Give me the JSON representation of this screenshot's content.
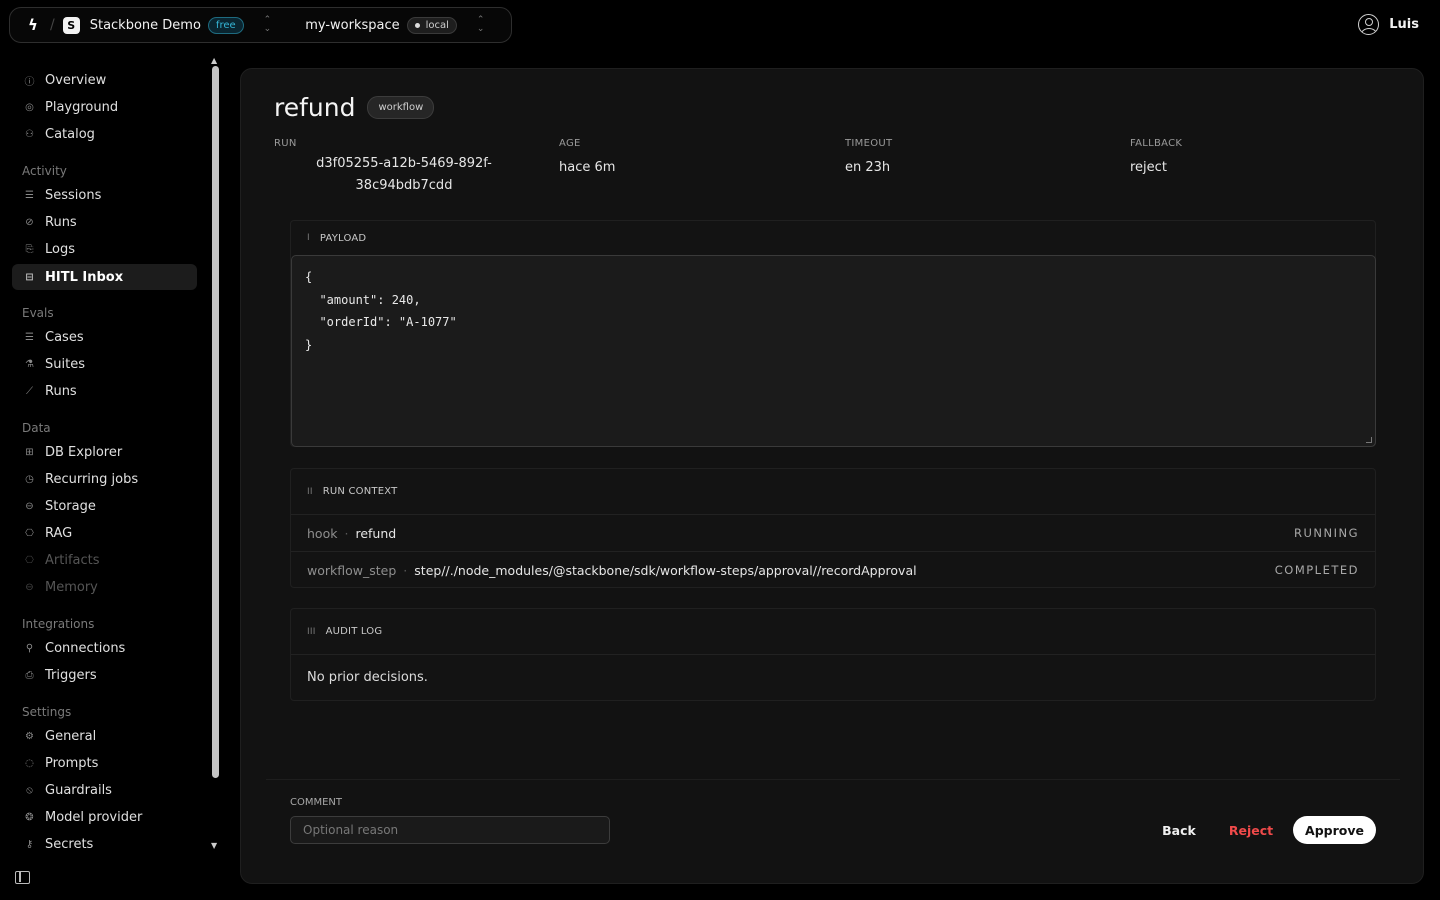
{
  "topbar": {
    "org_initial": "S",
    "org_name": "Stackbone Demo",
    "plan_badge": "free",
    "workspace_name": "my-workspace",
    "env_badge": "local",
    "user_name": "Luis"
  },
  "sidebar": {
    "top_items": [
      {
        "label": "Overview",
        "icon": "info-icon"
      },
      {
        "label": "Playground",
        "icon": "target-icon"
      },
      {
        "label": "Catalog",
        "icon": "users-icon"
      }
    ],
    "groups": [
      {
        "label": "Activity",
        "items": [
          {
            "label": "Sessions",
            "icon": "list-icon"
          },
          {
            "label": "Runs",
            "icon": "check-circle-icon"
          },
          {
            "label": "Logs",
            "icon": "scroll-icon"
          },
          {
            "label": "HITL Inbox",
            "icon": "inbox-icon",
            "active": true
          }
        ]
      },
      {
        "label": "Evals",
        "items": [
          {
            "label": "Cases",
            "icon": "list-check-icon"
          },
          {
            "label": "Suites",
            "icon": "flask-icon"
          },
          {
            "label": "Runs",
            "icon": "chart-line-icon"
          }
        ]
      },
      {
        "label": "Data",
        "items": [
          {
            "label": "DB Explorer",
            "icon": "table-icon"
          },
          {
            "label": "Recurring jobs",
            "icon": "clock-icon"
          },
          {
            "label": "Storage",
            "icon": "drive-icon"
          },
          {
            "label": "RAG",
            "icon": "book-icon"
          },
          {
            "label": "Artifacts",
            "icon": "file-icon",
            "disabled": true
          },
          {
            "label": "Memory",
            "icon": "brain-icon",
            "disabled": true
          }
        ]
      },
      {
        "label": "Integrations",
        "items": [
          {
            "label": "Connections",
            "icon": "plug-icon"
          },
          {
            "label": "Triggers",
            "icon": "zap-icon"
          }
        ]
      },
      {
        "label": "Settings",
        "items": [
          {
            "label": "General",
            "icon": "gear-icon"
          },
          {
            "label": "Prompts",
            "icon": "message-icon"
          },
          {
            "label": "Guardrails",
            "icon": "shield-off-icon"
          },
          {
            "label": "Model provider",
            "icon": "cpu-icon"
          },
          {
            "label": "Secrets",
            "icon": "key-icon"
          }
        ]
      }
    ]
  },
  "detail": {
    "title": "refund",
    "type_badge": "workflow",
    "meta": {
      "run_label": "RUN",
      "run_value": "d3f05255-a12b-5469-892f-38c94bdb7cdd",
      "age_label": "AGE",
      "age_value": "hace 6m",
      "timeout_label": "TIMEOUT",
      "timeout_value": "en 23h",
      "fallback_label": "FALLBACK",
      "fallback_value": "reject"
    },
    "payload": {
      "numeral": "I",
      "title": "PAYLOAD",
      "json": "{\n  \"amount\": 240,\n  \"orderId\": \"A-1077\"\n}"
    },
    "run_context": {
      "numeral": "II",
      "title": "RUN CONTEXT",
      "rows": [
        {
          "key": "hook",
          "value": "refund",
          "status": "RUNNING"
        },
        {
          "key": "workflow_step",
          "value": "step//./node_modules/@stackbone/sdk/workflow-steps/approval//recordApproval",
          "status": "COMPLETED"
        }
      ]
    },
    "audit_log": {
      "numeral": "III",
      "title": "AUDIT LOG",
      "empty_text": "No prior decisions."
    },
    "footer": {
      "comment_label": "COMMENT",
      "comment_placeholder": "Optional reason",
      "back_label": "Back",
      "reject_label": "Reject",
      "approve_label": "Approve"
    }
  },
  "colors": {
    "reject": "#f04a4a",
    "free_badge": "#35b6d6",
    "active_bg": "#1c1c1c"
  }
}
